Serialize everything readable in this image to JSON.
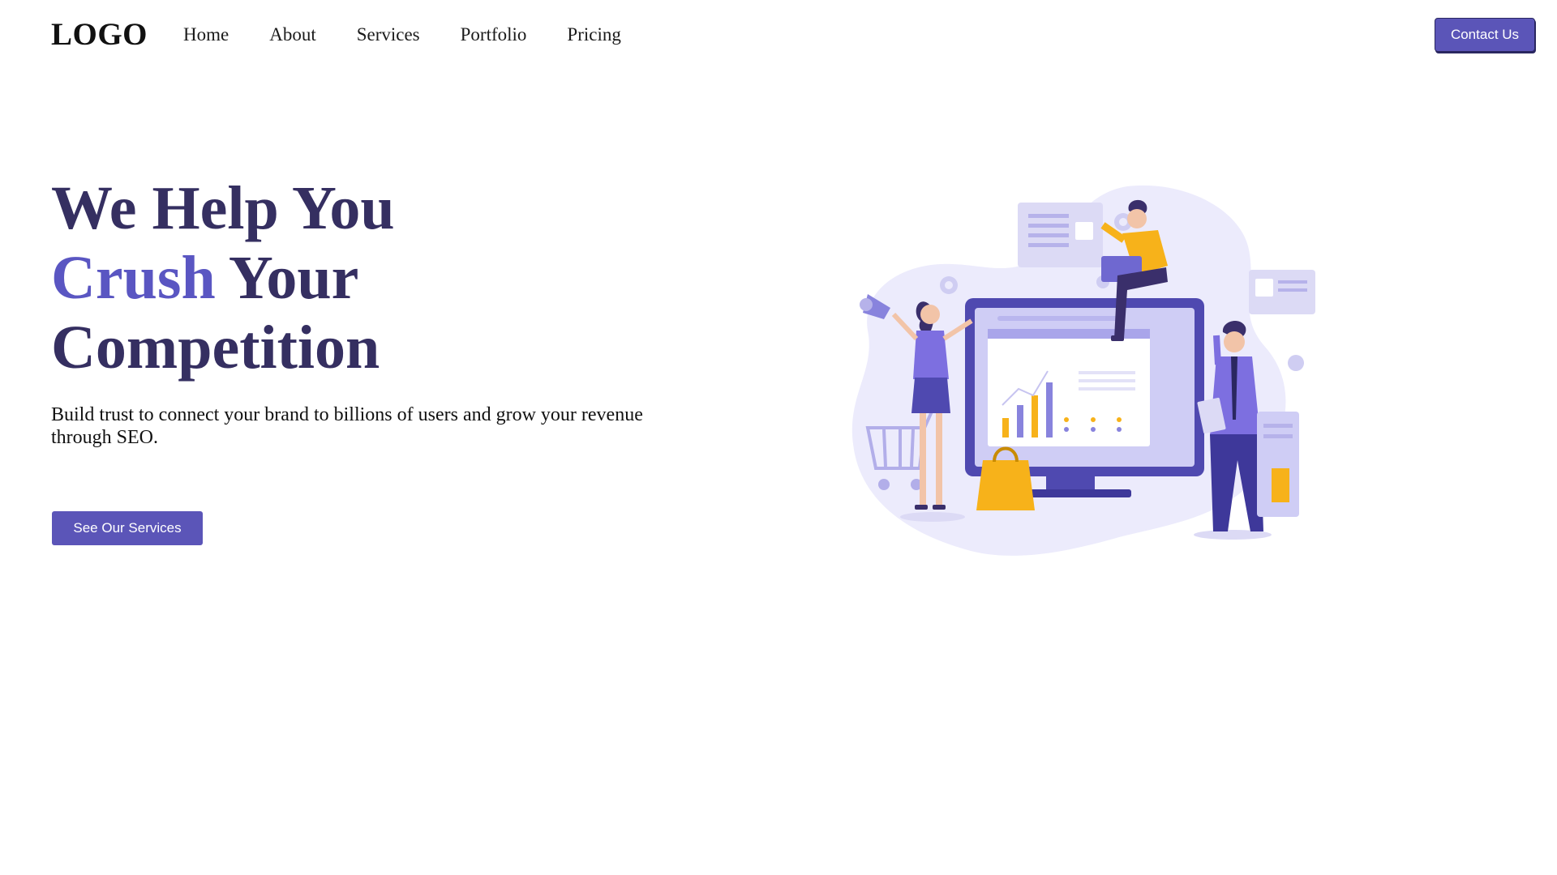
{
  "navbar": {
    "logo": "LOGO",
    "links": [
      {
        "label": "Home"
      },
      {
        "label": "About"
      },
      {
        "label": "Services"
      },
      {
        "label": "Portfolio"
      },
      {
        "label": "Pricing"
      }
    ],
    "contact_label": "Contact Us"
  },
  "hero": {
    "title_line1": "We Help You",
    "title_line2_accent": "Crush",
    "title_line2_rest": " Your",
    "title_line3": "Competition",
    "subtitle": "Build trust to connect your brand to billions of users and grow your revenue through SEO.",
    "cta_label": "See Our Services"
  },
  "colors": {
    "brand": "#5b55b8",
    "heading": "#352f61",
    "accent_text": "#5a56c2",
    "illustration_orange": "#f7b21a",
    "illustration_lavender": "#e9e8fb"
  },
  "illustration": {
    "icon_name": "seo-analytics-illustration"
  }
}
